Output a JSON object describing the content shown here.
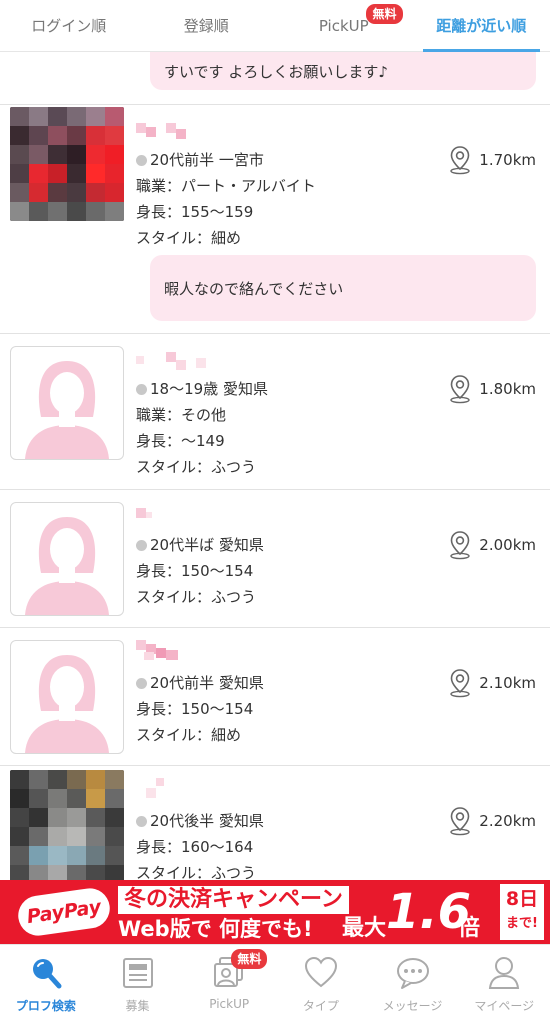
{
  "tabs": [
    {
      "label": "ログイン順",
      "active": false
    },
    {
      "label": "登録順",
      "active": false
    },
    {
      "label": "PickUP",
      "active": false,
      "badge": "無料"
    },
    {
      "label": "距離が近い順",
      "active": true
    }
  ],
  "top_message": "すいです よろしくお願いします♪",
  "profiles": [
    {
      "photo": "mosaic-red",
      "line1": "20代前半 一宮市",
      "job": "職業：パート・アルバイト",
      "height": "身長：155〜159",
      "style": "スタイル：細め",
      "distance": "1.70km",
      "message": "暇人なので絡んでください"
    },
    {
      "photo": "placeholder-woman",
      "line1": "18〜19歳 愛知県",
      "job": "職業：その他",
      "height": "身長：〜149",
      "style": "スタイル：ふつう",
      "distance": "1.80km"
    },
    {
      "photo": "placeholder-woman",
      "line1": "20代半ば 愛知県",
      "height": "身長：150〜154",
      "style": "スタイル：ふつう",
      "distance": "2.00km"
    },
    {
      "photo": "placeholder-woman",
      "line1": "20代前半 愛知県",
      "height": "身長：150〜154",
      "style": "スタイル：細め",
      "distance": "2.10km"
    },
    {
      "photo": "mosaic-gray",
      "line1": "20代後半 愛知県",
      "height": "身長：160〜164",
      "style": "スタイル：ふつう",
      "distance": "2.20km"
    }
  ],
  "banner": {
    "logo": "PayPay",
    "campaign_line1": "冬の決済キャンペーン",
    "campaign_line2": "Web版で 何度でも!",
    "max_label": "最大",
    "multiplier": "1.6",
    "multiplier_unit": "倍",
    "days_number": "8日",
    "days_suffix": "まで!",
    "background_color": "#e8192c"
  },
  "bottom_nav": [
    {
      "label": "プロフ検索",
      "icon": "search-icon",
      "active": true
    },
    {
      "label": "募集",
      "icon": "board-icon",
      "active": false
    },
    {
      "label": "PickUP",
      "icon": "photos-icon",
      "active": false,
      "badge": "無料"
    },
    {
      "label": "タイプ",
      "icon": "heart-icon",
      "active": false
    },
    {
      "label": "メッセージ",
      "icon": "chat-icon",
      "active": false
    },
    {
      "label": "マイページ",
      "icon": "person-icon",
      "active": false
    }
  ],
  "colors": {
    "accent": "#49a6e6",
    "badge": "#e8383d",
    "bubble": "#fde7ef",
    "placeholder_pink": "#f7c9d8"
  }
}
